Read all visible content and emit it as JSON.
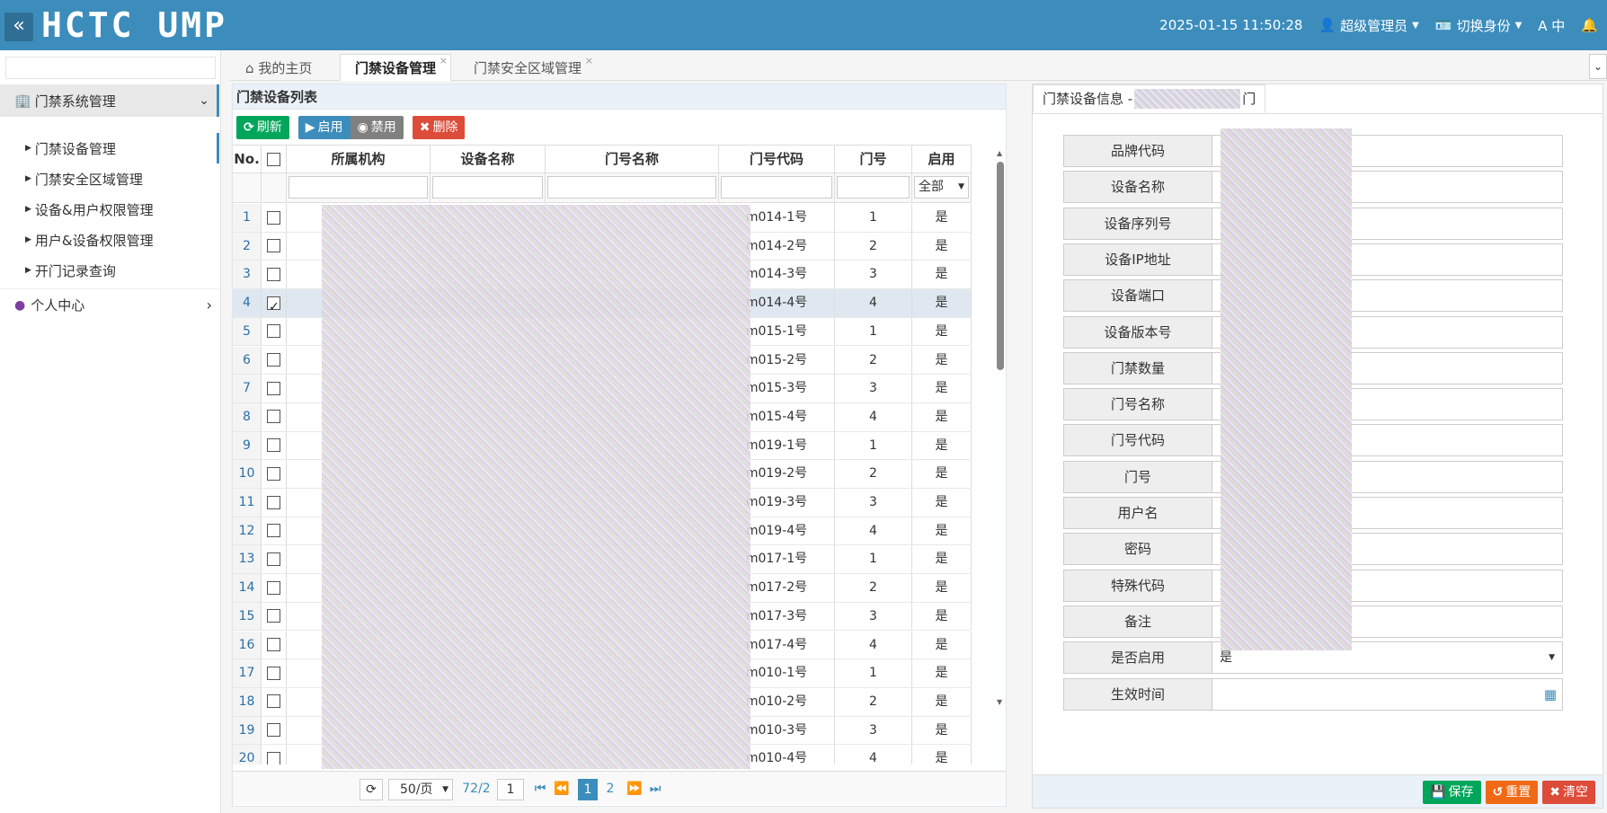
{
  "app": {
    "logo": "HCTC UMP",
    "datetime": "2025-01-15 11:50:28",
    "user": "超级管理员",
    "switch_identity": "切换身份",
    "font_label": "A 中"
  },
  "sidebar": {
    "group": "门禁系统管理",
    "items": [
      {
        "label": "门禁设备管理",
        "active": true
      },
      {
        "label": "门禁安全区域管理"
      },
      {
        "label": "设备&用户权限管理"
      },
      {
        "label": "用户&设备权限管理"
      },
      {
        "label": "开门记录查询"
      }
    ],
    "group2": "个人中心"
  },
  "tabs": [
    {
      "label": "我的主页",
      "icon": "home-icon"
    },
    {
      "label": "门禁设备管理",
      "active": true
    },
    {
      "label": "门禁安全区域管理"
    }
  ],
  "list": {
    "title": "门禁设备列表",
    "buttons": {
      "refresh": "刷新",
      "enable": "启用",
      "disable": "禁用",
      "delete": "删除"
    },
    "columns": [
      "No.",
      "",
      "所属机构",
      "设备名称",
      "门号名称",
      "门号代码",
      "门号",
      "启用"
    ],
    "filter_enable": "全部",
    "rows": [
      {
        "no": "1",
        "code": "m014-1号",
        "door": "1",
        "enabled": "是"
      },
      {
        "no": "2",
        "code": "m014-2号",
        "door": "2",
        "enabled": "是"
      },
      {
        "no": "3",
        "code": "m014-3号",
        "door": "3",
        "enabled": "是"
      },
      {
        "no": "4",
        "code": "m014-4号",
        "door": "4",
        "enabled": "是",
        "checked": true
      },
      {
        "no": "5",
        "code": "m015-1号",
        "door": "1",
        "enabled": "是"
      },
      {
        "no": "6",
        "code": "m015-2号",
        "door": "2",
        "enabled": "是"
      },
      {
        "no": "7",
        "code": "m015-3号",
        "door": "3",
        "enabled": "是"
      },
      {
        "no": "8",
        "code": "m015-4号",
        "door": "4",
        "enabled": "是"
      },
      {
        "no": "9",
        "code": "m019-1号",
        "door": "1",
        "enabled": "是"
      },
      {
        "no": "10",
        "code": "m019-2号",
        "door": "2",
        "enabled": "是"
      },
      {
        "no": "11",
        "code": "m019-3号",
        "door": "3",
        "enabled": "是"
      },
      {
        "no": "12",
        "code": "m019-4号",
        "door": "4",
        "enabled": "是"
      },
      {
        "no": "13",
        "code": "m017-1号",
        "door": "1",
        "enabled": "是"
      },
      {
        "no": "14",
        "code": "m017-2号",
        "door": "2",
        "enabled": "是"
      },
      {
        "no": "15",
        "code": "m017-3号",
        "door": "3",
        "enabled": "是"
      },
      {
        "no": "16",
        "code": "m017-4号",
        "door": "4",
        "enabled": "是"
      },
      {
        "no": "17",
        "code": "m010-1号",
        "door": "1",
        "enabled": "是"
      },
      {
        "no": "18",
        "code": "m010-2号",
        "door": "2",
        "enabled": "是"
      },
      {
        "no": "19",
        "code": "m010-3号",
        "door": "3",
        "enabled": "是"
      },
      {
        "no": "20",
        "code": "m010-4号",
        "door": "4",
        "enabled": "是"
      }
    ],
    "pager": {
      "size": "50/页",
      "total": "72/2",
      "page_input": "1",
      "pages": [
        "1",
        "2"
      ]
    }
  },
  "detail": {
    "tab_prefix": "门禁设备信息 -",
    "tab_suffix": "门",
    "fields": [
      {
        "label": "品牌代码",
        "value": ""
      },
      {
        "label": "设备名称",
        "value": ""
      },
      {
        "label": "设备序列号",
        "value": ""
      },
      {
        "label": "设备IP地址",
        "value": ""
      },
      {
        "label": "设备端口",
        "value": ""
      },
      {
        "label": "设备版本号",
        "value": ""
      },
      {
        "label": "门禁数量",
        "value": ""
      },
      {
        "label": "门号名称",
        "value": ""
      },
      {
        "label": "门号代码",
        "value": ""
      },
      {
        "label": "门号",
        "value": ""
      },
      {
        "label": "用户名",
        "value": ""
      },
      {
        "label": "密码",
        "value": ""
      },
      {
        "label": "特殊代码",
        "value": ""
      },
      {
        "label": "备注",
        "value": ""
      },
      {
        "label": "是否启用",
        "value": "是"
      },
      {
        "label": "生效时间",
        "value": ""
      }
    ],
    "buttons": {
      "save": "保存",
      "reset": "重置",
      "clear": "清空"
    }
  }
}
